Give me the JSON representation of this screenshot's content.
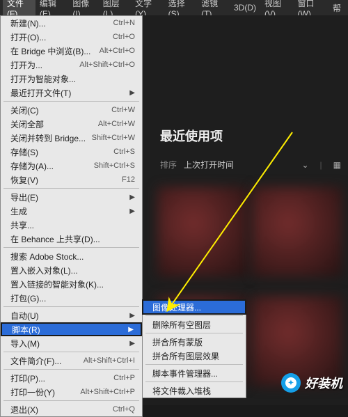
{
  "menubar": {
    "items": [
      "文件(F)",
      "编辑(E)",
      "图像(I)",
      "图层(L)",
      "文字(Y)",
      "选择(S)",
      "滤镜(T)",
      "3D(D)",
      "视图(V)",
      "窗口(W)",
      "帮"
    ]
  },
  "file_menu": {
    "groups": [
      [
        {
          "label": "新建(N)...",
          "shortcut": "Ctrl+N"
        },
        {
          "label": "打开(O)...",
          "shortcut": "Ctrl+O"
        },
        {
          "label": "在 Bridge 中浏览(B)...",
          "shortcut": "Alt+Ctrl+O"
        },
        {
          "label": "打开为...",
          "shortcut": "Alt+Shift+Ctrl+O"
        },
        {
          "label": "打开为智能对象..."
        },
        {
          "label": "最近打开文件(T)",
          "arrow": true
        }
      ],
      [
        {
          "label": "关闭(C)",
          "shortcut": "Ctrl+W"
        },
        {
          "label": "关闭全部",
          "shortcut": "Alt+Ctrl+W"
        },
        {
          "label": "关闭并转到 Bridge...",
          "shortcut": "Shift+Ctrl+W"
        },
        {
          "label": "存储(S)",
          "shortcut": "Ctrl+S"
        },
        {
          "label": "存储为(A)...",
          "shortcut": "Shift+Ctrl+S"
        },
        {
          "label": "恢复(V)",
          "shortcut": "F12"
        }
      ],
      [
        {
          "label": "导出(E)",
          "arrow": true
        },
        {
          "label": "生成",
          "arrow": true
        },
        {
          "label": "共享..."
        },
        {
          "label": "在 Behance 上共享(D)..."
        }
      ],
      [
        {
          "label": "搜索 Adobe Stock..."
        },
        {
          "label": "置入嵌入对象(L)..."
        },
        {
          "label": "置入链接的智能对象(K)..."
        },
        {
          "label": "打包(G)..."
        }
      ],
      [
        {
          "label": "自动(U)",
          "arrow": true
        },
        {
          "label": "脚本(R)",
          "arrow": true,
          "highlighted": true,
          "boxed": true
        },
        {
          "label": "导入(M)",
          "arrow": true
        }
      ],
      [
        {
          "label": "文件简介(F)...",
          "shortcut": "Alt+Shift+Ctrl+I"
        }
      ],
      [
        {
          "label": "打印(P)...",
          "shortcut": "Ctrl+P"
        },
        {
          "label": "打印一份(Y)",
          "shortcut": "Alt+Shift+Ctrl+P"
        }
      ],
      [
        {
          "label": "退出(X)",
          "shortcut": "Ctrl+Q"
        }
      ]
    ]
  },
  "script_submenu": {
    "groups": [
      [
        {
          "label": "图像处理器...",
          "highlighted": true
        }
      ],
      [
        {
          "label": "删除所有空图层"
        }
      ],
      [
        {
          "label": "拼合所有蒙版"
        },
        {
          "label": "拼合所有图层效果"
        }
      ],
      [
        {
          "label": "脚本事件管理器..."
        }
      ],
      [
        {
          "label": "将文件裁入堆栈"
        }
      ]
    ]
  },
  "recent": {
    "title": "最近使用项",
    "sort_label": "排序",
    "sort_value": "上次打开时间"
  },
  "watermark": {
    "text": "好装机"
  }
}
